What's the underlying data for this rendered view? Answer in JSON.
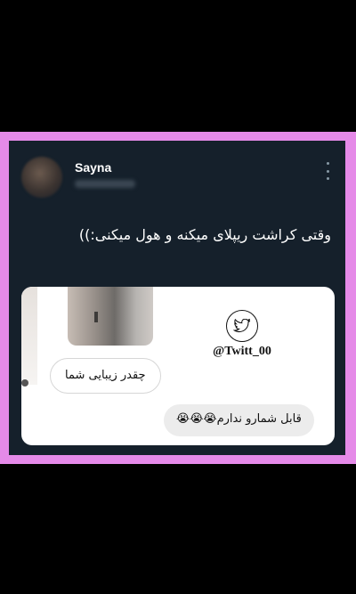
{
  "post": {
    "author_name": "Sayna",
    "text": "وقتی کراشت ریپلای میکنه و هول میکنی:))"
  },
  "screenshot": {
    "watermark": "@Twitt_00",
    "bubble_left": "چقدر زیبایی شما",
    "bubble_right": "قابل شمارو ندارم😭😭😭"
  },
  "icons": {
    "menu": "more-vertical-icon",
    "watermark_logo": "twitter-bird-icon"
  },
  "colors": {
    "frame_border": "#e58ae8",
    "tweet_background": "#15202b",
    "page_background": "#000000"
  }
}
